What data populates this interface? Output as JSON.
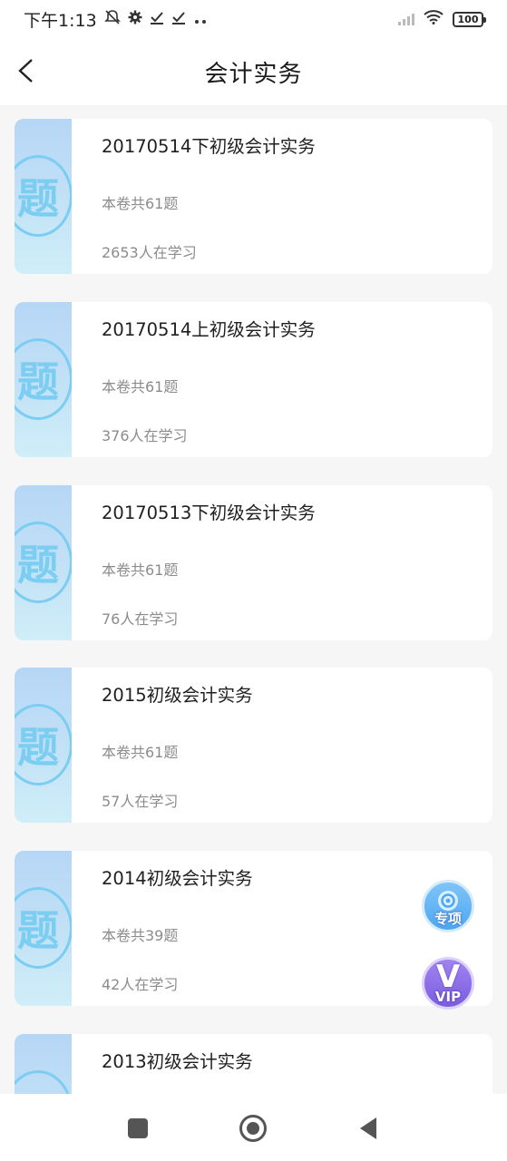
{
  "status_bar": {
    "time": "下午1:13",
    "icons": [
      "mute-icon",
      "gear-icon",
      "check-icon",
      "check-icon",
      "more-dots-icon"
    ],
    "battery": "100"
  },
  "header": {
    "title": "会计实务"
  },
  "papers": [
    {
      "title": "20170514下初级会计实务",
      "count": "本卷共61题",
      "learners": "2653人在学习",
      "thumb_char": "题"
    },
    {
      "title": "20170514上初级会计实务",
      "count": "本卷共61题",
      "learners": "376人在学习",
      "thumb_char": "题"
    },
    {
      "title": "20170513下初级会计实务",
      "count": "本卷共61题",
      "learners": "76人在学习",
      "thumb_char": "题"
    },
    {
      "title": "2015初级会计实务",
      "count": "本卷共61题",
      "learners": "57人在学习",
      "thumb_char": "题"
    },
    {
      "title": "2014初级会计实务",
      "count": "本卷共39题",
      "learners": "42人在学习",
      "thumb_char": "题"
    },
    {
      "title": "2013初级会计实务",
      "count": "",
      "learners": "",
      "thumb_char": "题"
    }
  ],
  "floating": {
    "special_label": "专项",
    "vip_label": "VIP",
    "vip_glyph": "V"
  },
  "colors": {
    "accent_blue": "#7ccdf2",
    "special_button": "#5aaef2",
    "vip_button": "#8a6de8",
    "background": "#f6f6f6"
  }
}
